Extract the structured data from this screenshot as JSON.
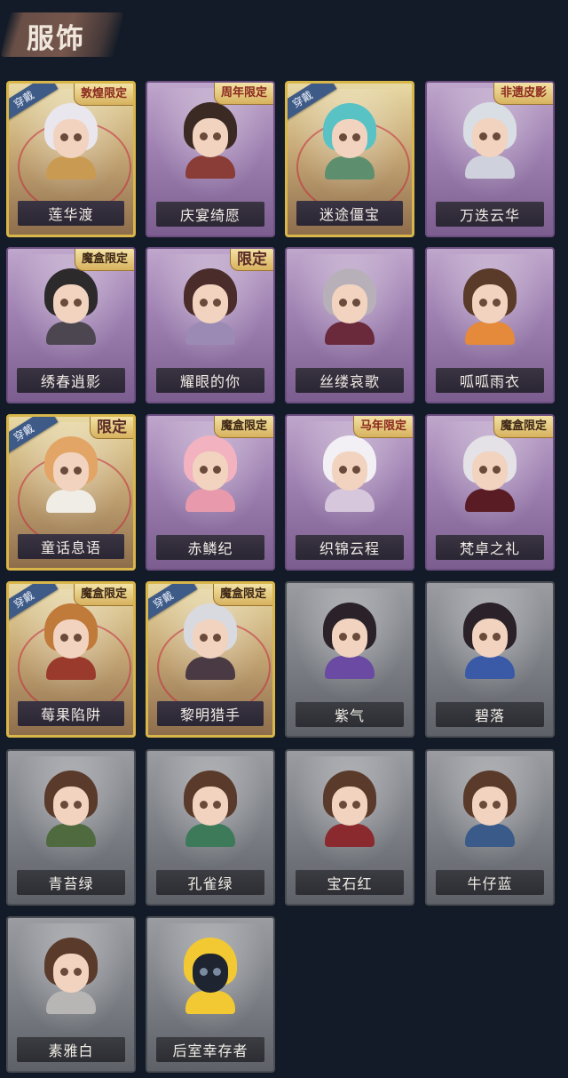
{
  "header": {
    "title": "服饰"
  },
  "cards": [
    {
      "name": "莲华渡",
      "style": "gold",
      "worn": true,
      "tag": "敦煌限定",
      "hair": "#e9e6ee",
      "body": "#c99a52"
    },
    {
      "name": "庆宴绮愿",
      "style": "purple",
      "worn": false,
      "tag": "周年限定",
      "hair": "#3b2a24",
      "body": "#8a3c36"
    },
    {
      "name": "迷途僵宝",
      "style": "gold",
      "worn": true,
      "tag": "",
      "hair": "#59c2c5",
      "body": "#5d8f6e"
    },
    {
      "name": "万迭云华",
      "style": "purple",
      "worn": false,
      "tag": "非遗皮影",
      "hair": "#d9dde4",
      "body": "#cfd2dc"
    },
    {
      "name": "绣春逍影",
      "style": "purple",
      "worn": false,
      "tag": "魔盒限定",
      "hair": "#2d2a2c",
      "body": "#4b4650"
    },
    {
      "name": "耀眼的你",
      "style": "purple",
      "worn": false,
      "tag": "限定",
      "hair": "#4a2c2a",
      "body": "#9a8ab4"
    },
    {
      "name": "丝缕哀歌",
      "style": "purple",
      "worn": false,
      "tag": "",
      "hair": "#b8b0b8",
      "body": "#6a2a3c"
    },
    {
      "name": "呱呱雨衣",
      "style": "purple",
      "worn": false,
      "tag": "",
      "hair": "#5a3a28",
      "body": "#e48a3a"
    },
    {
      "name": "童话息语",
      "style": "gold",
      "worn": true,
      "tag": "限定",
      "hair": "#e2a566",
      "body": "#f0ece6"
    },
    {
      "name": "赤鳞纪",
      "style": "purple",
      "worn": false,
      "tag": "魔盒限定",
      "hair": "#f2b2c0",
      "body": "#e89aac"
    },
    {
      "name": "织锦云程",
      "style": "purple",
      "worn": false,
      "tag": "马年限定",
      "hair": "#f2f0f4",
      "body": "#d6c7dc"
    },
    {
      "name": "梵卓之礼",
      "style": "purple",
      "worn": false,
      "tag": "魔盒限定",
      "hair": "#e4e2e6",
      "body": "#5a1c24"
    },
    {
      "name": "莓果陷阱",
      "style": "gold",
      "worn": true,
      "tag": "魔盒限定",
      "hair": "#c07a3a",
      "body": "#9a3a2c"
    },
    {
      "name": "黎明猎手",
      "style": "gold",
      "worn": true,
      "tag": "魔盒限定",
      "hair": "#d8dadf",
      "body": "#4a3a44"
    },
    {
      "name": "紫气",
      "style": "gray",
      "worn": false,
      "tag": "",
      "hair": "#2a2228",
      "body": "#6a4aa2"
    },
    {
      "name": "碧落",
      "style": "gray",
      "worn": false,
      "tag": "",
      "hair": "#2a2228",
      "body": "#3a5aa8"
    },
    {
      "name": "青苔绿",
      "style": "gray",
      "worn": false,
      "tag": "",
      "hair": "#5a3a2a",
      "body": "#4f6a3e"
    },
    {
      "name": "孔雀绿",
      "style": "gray",
      "worn": false,
      "tag": "",
      "hair": "#5a3a2a",
      "body": "#3c7a5a"
    },
    {
      "name": "宝石红",
      "style": "gray",
      "worn": false,
      "tag": "",
      "hair": "#5a3a2a",
      "body": "#8a2a2e"
    },
    {
      "name": "牛仔蓝",
      "style": "gray",
      "worn": false,
      "tag": "",
      "hair": "#5a3a2a",
      "body": "#3a5a8a"
    },
    {
      "name": "素雅白",
      "style": "gray",
      "worn": false,
      "tag": "",
      "hair": "#5a3a2a",
      "body": "#b8b6b4"
    },
    {
      "name": "后室幸存者",
      "style": "gray",
      "worn": false,
      "tag": "",
      "hair": "#f2c932",
      "body": "#f2c932"
    }
  ],
  "labels": {
    "worn": "穿戴"
  }
}
